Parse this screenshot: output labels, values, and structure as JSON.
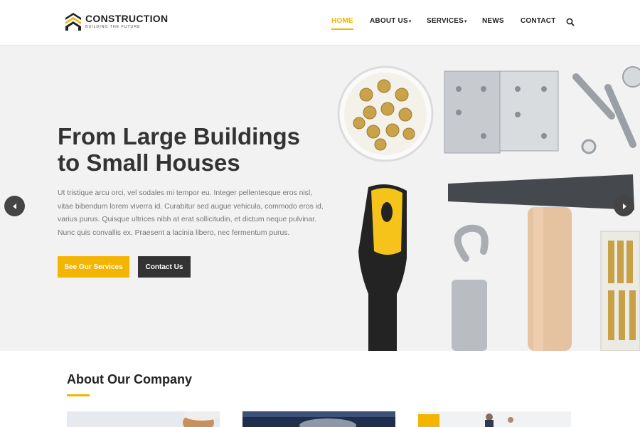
{
  "brand": {
    "name": "CONSTRUCTION",
    "tagline": "BUILDING THE FUTURE"
  },
  "nav": {
    "items": [
      {
        "label": "HOME",
        "active": true
      },
      {
        "label": "ABOUT US",
        "dropdown": true
      },
      {
        "label": "SERVICES",
        "dropdown": true
      },
      {
        "label": "NEWS"
      },
      {
        "label": "CONTACT"
      }
    ],
    "search_icon": "search-icon"
  },
  "hero": {
    "title": "From Large Buildings\nto Small Houses",
    "text": "Ut tristique arcu orci, vel sodales mi tempor eu. Integer pellentesque eros nisl, vitae bibendum lorem viverra id. Curabitur sed augue vehicula, commodo eros id, varius purus. Quisque ultrices nibh at erat sollicitudin, et dictum neque pulvinar. Nunc quis convallis ex. Praesent a lacinia libero, nec fermentum purus.",
    "primary_button": "See Our Services",
    "secondary_button": "Contact Us",
    "prev_icon": "chevron-left-icon",
    "next_icon": "chevron-right-icon"
  },
  "about": {
    "title": "About Our Company"
  },
  "colors": {
    "accent": "#f5b400",
    "dark": "#333333",
    "hero_bg": "#f2f2f2"
  }
}
